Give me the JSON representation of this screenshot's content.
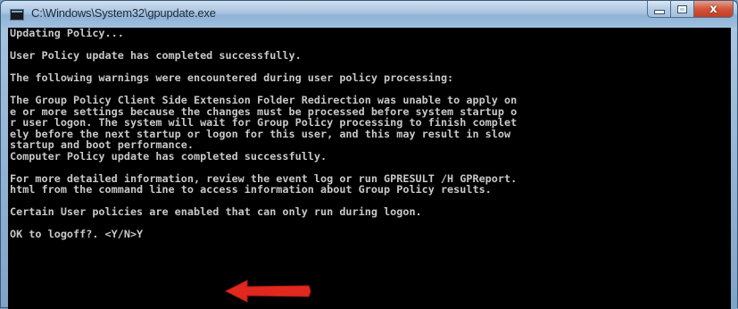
{
  "window": {
    "title": "C:\\Windows\\System32\\gpupdate.exe",
    "controls": {
      "minimize_icon": "minimize-icon",
      "maximize_icon": "maximize-icon",
      "close_icon": "close-icon",
      "close_glyph": "x"
    }
  },
  "console": {
    "lines": [
      "Updating Policy...",
      "",
      "User Policy update has completed successfully.",
      "",
      "The following warnings were encountered during user policy processing:",
      "",
      "The Group Policy Client Side Extension Folder Redirection was unable to apply on",
      "e or more settings because the changes must be processed before system startup o",
      "r user logon. The system will wait for Group Policy processing to finish complet",
      "ely before the next startup or logon for this user, and this may result in slow",
      "startup and boot performance.",
      "Computer Policy update has completed successfully.",
      "",
      "For more detailed information, review the event log or run GPRESULT /H GPReport.",
      "html from the command line to access information about Group Policy results.",
      "",
      "Certain User policies are enabled that can only run during logon.",
      "",
      "OK to logoff?. <Y/N>Y"
    ],
    "text_color": "#c8c8c8",
    "background_color": "#000000"
  },
  "annotation": {
    "arrow_icon": "red-arrow-icon",
    "arrow_color": "#e0281e"
  }
}
